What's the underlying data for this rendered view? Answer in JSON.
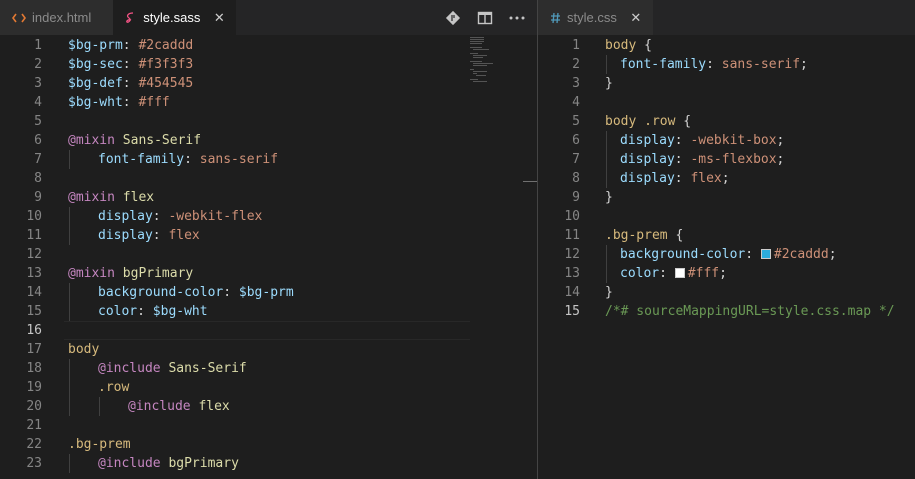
{
  "left_pane": {
    "tabs": [
      {
        "label": "index.html",
        "icon": "html-code-icon",
        "active": false
      },
      {
        "label": "style.sass",
        "icon": "sass-icon",
        "active": true,
        "close": "✕"
      }
    ],
    "actions": [
      "git-compare-icon",
      "split-editor-icon",
      "more-actions-icon"
    ],
    "current_line": 16,
    "lines": [
      {
        "n": "1",
        "i": 0,
        "t": [
          [
            "t-var",
            "$bg-prm"
          ],
          [
            "t-punct",
            ": "
          ],
          [
            "t-val",
            "#2caddd"
          ]
        ]
      },
      {
        "n": "2",
        "i": 0,
        "t": [
          [
            "t-var",
            "$bg-sec"
          ],
          [
            "t-punct",
            ": "
          ],
          [
            "t-val",
            "#f3f3f3"
          ]
        ]
      },
      {
        "n": "3",
        "i": 0,
        "t": [
          [
            "t-var",
            "$bg-def"
          ],
          [
            "t-punct",
            ": "
          ],
          [
            "t-val",
            "#454545"
          ]
        ]
      },
      {
        "n": "4",
        "i": 0,
        "t": [
          [
            "t-var",
            "$bg-wht"
          ],
          [
            "t-punct",
            ": "
          ],
          [
            "t-val",
            "#fff"
          ]
        ]
      },
      {
        "n": "5",
        "i": 0,
        "t": []
      },
      {
        "n": "6",
        "i": 0,
        "t": [
          [
            "t-at",
            "@mixin"
          ],
          [
            "t-punct",
            " "
          ],
          [
            "t-name",
            "Sans-Serif"
          ]
        ]
      },
      {
        "n": "7",
        "i": 1,
        "t": [
          [
            "t-prop",
            "font-family"
          ],
          [
            "t-punct",
            ": "
          ],
          [
            "t-val",
            "sans-serif"
          ]
        ]
      },
      {
        "n": "8",
        "i": 0,
        "t": []
      },
      {
        "n": "9",
        "i": 0,
        "t": [
          [
            "t-at",
            "@mixin"
          ],
          [
            "t-punct",
            " "
          ],
          [
            "t-name",
            "flex"
          ]
        ]
      },
      {
        "n": "10",
        "i": 1,
        "t": [
          [
            "t-prop",
            "display"
          ],
          [
            "t-punct",
            ": "
          ],
          [
            "t-val",
            "-webkit-flex"
          ]
        ]
      },
      {
        "n": "11",
        "i": 1,
        "t": [
          [
            "t-prop",
            "display"
          ],
          [
            "t-punct",
            ": "
          ],
          [
            "t-val",
            "flex"
          ]
        ]
      },
      {
        "n": "12",
        "i": 0,
        "t": []
      },
      {
        "n": "13",
        "i": 0,
        "t": [
          [
            "t-at",
            "@mixin"
          ],
          [
            "t-punct",
            " "
          ],
          [
            "t-name",
            "bgPrimary"
          ]
        ]
      },
      {
        "n": "14",
        "i": 1,
        "t": [
          [
            "t-prop",
            "background-color"
          ],
          [
            "t-punct",
            ": "
          ],
          [
            "t-var",
            "$bg-prm"
          ]
        ]
      },
      {
        "n": "15",
        "i": 1,
        "t": [
          [
            "t-prop",
            "color"
          ],
          [
            "t-punct",
            ": "
          ],
          [
            "t-var",
            "$bg-wht"
          ]
        ]
      },
      {
        "n": "16",
        "i": 0,
        "t": []
      },
      {
        "n": "17",
        "i": 0,
        "t": [
          [
            "t-sel",
            "body"
          ]
        ]
      },
      {
        "n": "18",
        "i": 1,
        "t": [
          [
            "t-at",
            "@include"
          ],
          [
            "t-punct",
            " "
          ],
          [
            "t-name",
            "Sans-Serif"
          ]
        ]
      },
      {
        "n": "19",
        "i": 1,
        "t": [
          [
            "t-sel",
            ".row"
          ]
        ]
      },
      {
        "n": "20",
        "i": 2,
        "t": [
          [
            "t-at",
            "@include"
          ],
          [
            "t-punct",
            " "
          ],
          [
            "t-name",
            "flex"
          ]
        ]
      },
      {
        "n": "21",
        "i": 0,
        "t": []
      },
      {
        "n": "22",
        "i": 0,
        "t": [
          [
            "t-sel",
            ".bg-prem"
          ]
        ]
      },
      {
        "n": "23",
        "i": 1,
        "t": [
          [
            "t-at",
            "@include"
          ],
          [
            "t-punct",
            " "
          ],
          [
            "t-name",
            "bgPrimary"
          ]
        ]
      }
    ]
  },
  "right_pane": {
    "tabs": [
      {
        "label": "style.css",
        "icon": "css-hash-icon",
        "active": false,
        "close": "✕"
      }
    ],
    "current_line": 15,
    "lines": [
      {
        "n": "1",
        "i": 0,
        "t": [
          [
            "t-sel",
            "body"
          ],
          [
            "t-punct",
            " {"
          ]
        ]
      },
      {
        "n": "2",
        "i": 1,
        "t": [
          [
            "t-prop",
            "font-family"
          ],
          [
            "t-punct",
            ": "
          ],
          [
            "t-val",
            "sans-serif"
          ],
          [
            "t-punct",
            ";"
          ]
        ]
      },
      {
        "n": "3",
        "i": 0,
        "t": [
          [
            "t-punct",
            "}"
          ]
        ]
      },
      {
        "n": "4",
        "i": 0,
        "t": []
      },
      {
        "n": "5",
        "i": 0,
        "t": [
          [
            "t-sel",
            "body .row"
          ],
          [
            "t-punct",
            " {"
          ]
        ]
      },
      {
        "n": "6",
        "i": 1,
        "t": [
          [
            "t-prop",
            "display"
          ],
          [
            "t-punct",
            ": "
          ],
          [
            "t-val",
            "-webkit-box"
          ],
          [
            "t-punct",
            ";"
          ]
        ]
      },
      {
        "n": "7",
        "i": 1,
        "t": [
          [
            "t-prop",
            "display"
          ],
          [
            "t-punct",
            ": "
          ],
          [
            "t-val",
            "-ms-flexbox"
          ],
          [
            "t-punct",
            ";"
          ]
        ]
      },
      {
        "n": "8",
        "i": 1,
        "t": [
          [
            "t-prop",
            "display"
          ],
          [
            "t-punct",
            ": "
          ],
          [
            "t-val",
            "flex"
          ],
          [
            "t-punct",
            ";"
          ]
        ]
      },
      {
        "n": "9",
        "i": 0,
        "t": [
          [
            "t-punct",
            "}"
          ]
        ]
      },
      {
        "n": "10",
        "i": 0,
        "t": []
      },
      {
        "n": "11",
        "i": 0,
        "t": [
          [
            "t-sel",
            ".bg-prem"
          ],
          [
            "t-punct",
            " {"
          ]
        ]
      },
      {
        "n": "12",
        "i": 1,
        "t": [
          [
            "t-prop",
            "background-color"
          ],
          [
            "t-punct",
            ": "
          ],
          [
            "swatch",
            "#2caddd"
          ],
          [
            "t-val",
            "#2caddd"
          ],
          [
            "t-punct",
            ";"
          ]
        ]
      },
      {
        "n": "13",
        "i": 1,
        "t": [
          [
            "t-prop",
            "color"
          ],
          [
            "t-punct",
            ": "
          ],
          [
            "swatch",
            "#ffffff"
          ],
          [
            "t-val",
            "#fff"
          ],
          [
            "t-punct",
            ";"
          ]
        ]
      },
      {
        "n": "14",
        "i": 0,
        "t": [
          [
            "t-punct",
            "}"
          ]
        ]
      },
      {
        "n": "15",
        "i": 0,
        "t": [
          [
            "t-comment",
            "/*# sourceMappingURL=style.css.map */"
          ]
        ]
      }
    ]
  },
  "colors": {
    "editor_bg": "#1e1e1e",
    "tabbar_bg": "#252526",
    "html_icon": "#e37933",
    "sass_icon": "#f55385",
    "css_icon": "#519aba"
  }
}
